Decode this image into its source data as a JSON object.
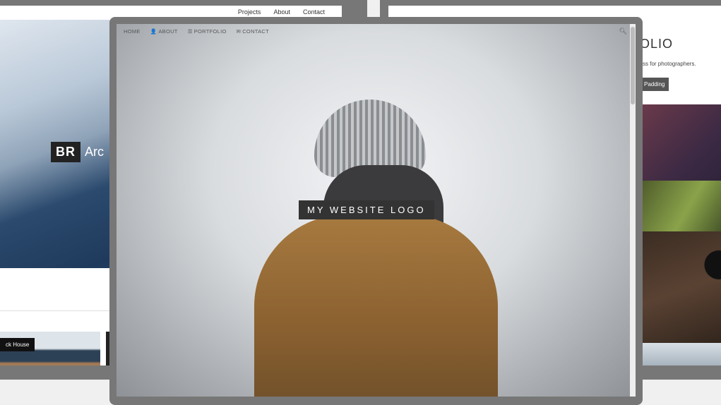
{
  "left_site": {
    "nav": [
      "Projects",
      "About",
      "Contact"
    ],
    "brand_badge": "BR",
    "brand_text": "Arc",
    "caption": "ck House"
  },
  "right_site": {
    "title": "OLIO",
    "subtitle": "css for photographers.",
    "button": "Padding"
  },
  "main_site": {
    "nav": [
      {
        "label": "HOME",
        "icon": ""
      },
      {
        "label": "ABOUT",
        "icon": "user-icon",
        "glyph": "👤"
      },
      {
        "label": "PORTFOLIO",
        "icon": "list-icon",
        "glyph": "☰"
      },
      {
        "label": "CONTACT",
        "icon": "envelope-icon",
        "glyph": "✉"
      }
    ],
    "logo": "MY WEBSITE LOGO",
    "search_icon": "search-icon"
  }
}
